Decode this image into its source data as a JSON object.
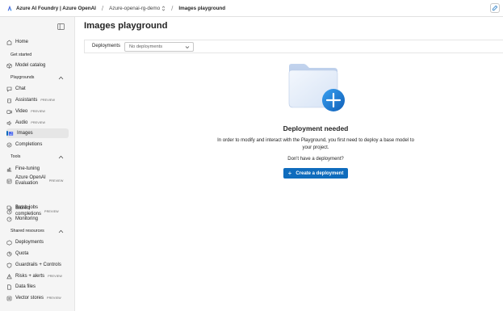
{
  "topbar": {
    "brand": "Azure AI Foundry | Azure OpenAI",
    "crumb_resource": "Azure-openai-rg-demo",
    "crumb_page": "Images playground"
  },
  "sidebar": {
    "home": "Home",
    "get_started": "Get started",
    "model_catalog": "Model catalog",
    "playgrounds": "Playgrounds",
    "chat": "Chat",
    "assistants": "Assistants",
    "video": "Video",
    "audio": "Audio",
    "images": "Images",
    "completions": "Completions",
    "tools": "Tools",
    "fine_tuning": "Fine-tuning",
    "aoai_eval_l1": "Azure OpenAI",
    "aoai_eval_l2": "Evaluation",
    "stored_l1": "Stored",
    "stored_l2": "completions",
    "batch_jobs": "Batch jobs",
    "monitoring": "Monitoring",
    "shared_resources": "Shared resources",
    "deployments": "Deployments",
    "quota": "Quota",
    "guardrails": "Guardrails + Controls",
    "risks": "Risks + alerts",
    "data_files": "Data files",
    "vector_stores": "Vector stores",
    "preview_badge": "PREVIEW"
  },
  "main": {
    "title": "Images playground",
    "deployments_label": "Deployments",
    "deployments_value": "No deployments",
    "empty_title": "Deployment needed",
    "empty_desc": "In order to modify and interact with the Playground, you first need to deploy a base model to your project.",
    "empty_question": "Don't have a deployment?",
    "create_button": "Create a deployment"
  },
  "colors": {
    "accent": "#0f6cbd",
    "sidebar_bg": "#f5f5f5"
  }
}
